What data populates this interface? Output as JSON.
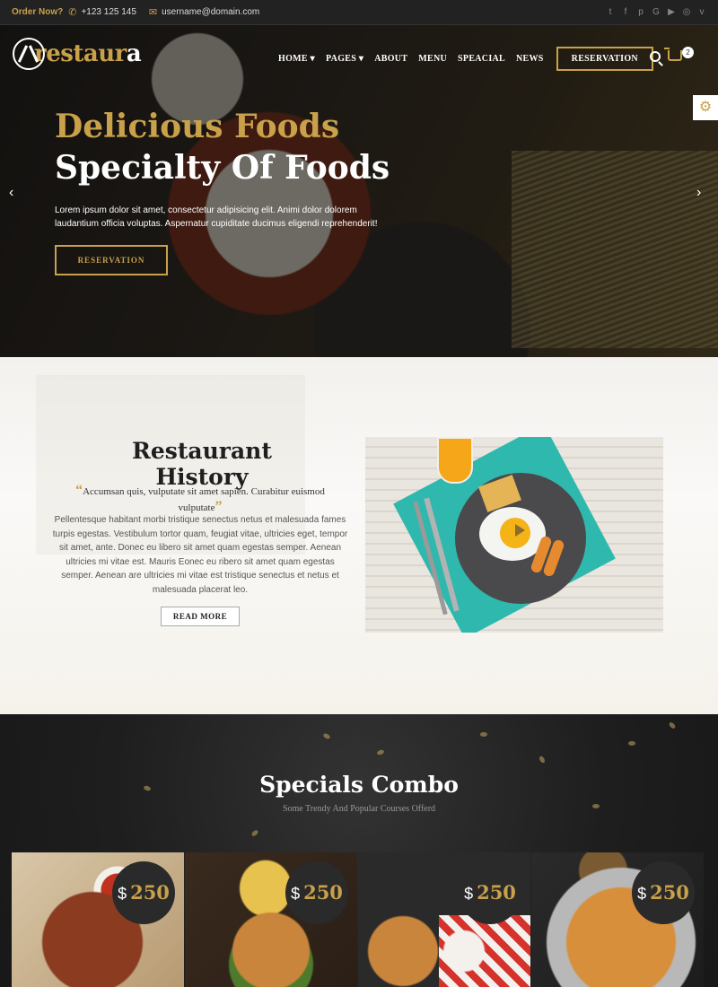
{
  "topbar": {
    "order_label": "Order Now?",
    "phone": "+123 125 145",
    "email": "username@domain.com",
    "social_icons": [
      "twitter-icon",
      "facebook-icon",
      "pinterest-icon",
      "google-icon",
      "youtube-icon",
      "instagram-icon",
      "vimeo-icon"
    ]
  },
  "logo": {
    "text_gold": "restaur",
    "text_white": "a"
  },
  "nav": {
    "items": [
      "HOME ▾",
      "PAGES ▾",
      "ABOUT",
      "MENU",
      "SPEACIAL",
      "NEWS"
    ],
    "reservation": "RESERVATION",
    "cart_count": "2"
  },
  "hero": {
    "title_gold": "Delicious Foods",
    "title_white": "Specialty Of Foods",
    "text": "Lorem ipsum dolor sit amet, consectetur adipisicing elit. Animi dolor dolorem laudantium officia voluptas. Aspernatur cupiditate ducimus eligendi reprehenderit!",
    "button": "RESERVATION"
  },
  "history": {
    "title": "Restaurant History",
    "quote": "Accumsan quis, vulputate sit amet sapien. Curabitur euismod vulputate",
    "body": "Pellentesque habitant morbi tristique senectus netus et malesuada fames turpis egestas. Vestibulum tortor quam, feugiat vitae, ultricies eget, tempor sit amet, ante. Donec eu libero sit amet quam egestas semper. Aenean ultricies mi vitae est. Mauris Eonec eu ribero sit amet quam egestas semper. Aenean are ultricies mi vitae est tristique senectus et netus et malesuada placerat leo.",
    "button": "READ MORE"
  },
  "specials": {
    "title": "Specials Combo",
    "subtitle": "Some Trendy And Popular Courses Offerd",
    "cards": [
      {
        "currency": "$",
        "price": "250"
      },
      {
        "currency": "$",
        "price": "250"
      },
      {
        "currency": "$",
        "price": "250"
      },
      {
        "currency": "$",
        "price": "250"
      }
    ]
  },
  "colors": {
    "accent": "#c9a14a",
    "dark": "#1c1c1c"
  }
}
